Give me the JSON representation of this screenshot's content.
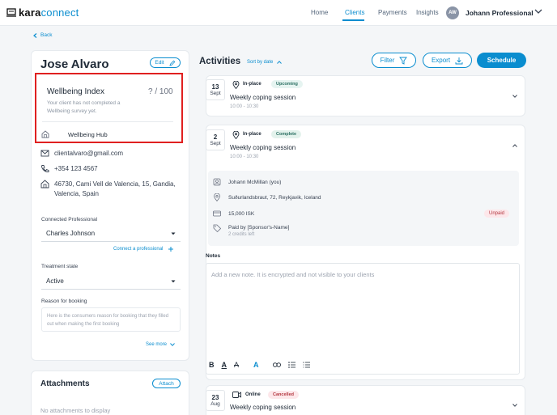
{
  "brand": {
    "name_bold": "kara",
    "name_light": "connect"
  },
  "nav": {
    "items": [
      "Home",
      "Clients",
      "Payments",
      "Insights"
    ],
    "active": "Clients",
    "avatar_initials": "AW",
    "user_name": "Johann Professional"
  },
  "back_label": "Back",
  "client": {
    "name": "Jose Alvaro",
    "edit_label": "Edit",
    "wellbeing": {
      "title": "Wellbeing Index",
      "score": "? / 100",
      "description": "Your client has not completed a Wellbeing survey yet.",
      "hub_label": "Wellbeing Hub"
    },
    "email": "clientalvaro@gmail.com",
    "phone": "+354 123 4567",
    "address": "46730, Cami Vell de Valencia, 15, Gandia, Valencia, Spain",
    "connected_professional_label": "Connected Professional",
    "connected_professional_value": "Charles Johnson",
    "connect_link": "Connect a professional",
    "treatment_state_label": "Treatment state",
    "treatment_state_value": "Active",
    "reason_label": "Reason for booking",
    "reason_placeholder": "Here is the consumers reason for booking that they filled out when making the first booking",
    "see_more": "See more"
  },
  "attachments": {
    "title": "Attachments",
    "attach_label": "Attach",
    "empty_text": "No attachments to display"
  },
  "activities": {
    "title": "Activities",
    "sort_label": "Sort by date",
    "filter_label": "Filter",
    "export_label": "Export",
    "schedule_label": "Schedule",
    "sessions": [
      {
        "day": "13",
        "month": "Sept",
        "type": "In-place",
        "status": "Upcoming",
        "title": "Weekly coping session",
        "time": "10:00 - 10:30"
      },
      {
        "day": "2",
        "month": "Sept",
        "type": "In-place",
        "status": "Complete",
        "title": "Weekly coping session",
        "time": "10:00 - 10:30"
      },
      {
        "day": "23",
        "month": "Aug",
        "type": "Online",
        "status": "Cancelled",
        "title": "Weekly coping session",
        "time": ""
      }
    ],
    "details": {
      "professional": "Johann McMillan (you)",
      "location": "Suðurlandsbraut, 72, Reykjavik, Iceland",
      "price": "15,000 ISK",
      "payment_status": "Unpaid",
      "paid_by": "Paid by [Sponsor's-Name]",
      "credits_left": "2 credits left"
    },
    "notes_label": "Notes",
    "notes_placeholder": "Add a new note. It is encrypted and not visible to your clients",
    "toolbar": [
      "B",
      "A",
      "A",
      "A"
    ]
  },
  "colors": {
    "accent": "#0a8dcf",
    "highlight_border": "#e02020"
  }
}
